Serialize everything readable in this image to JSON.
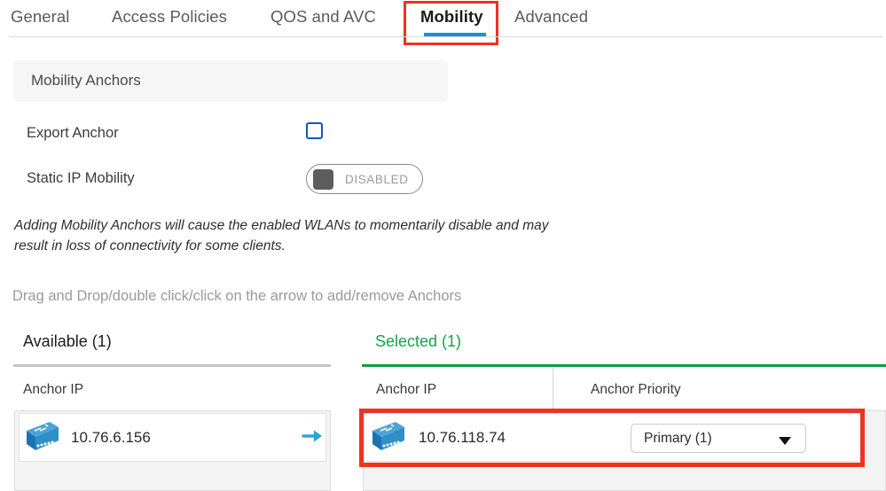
{
  "tabs": [
    {
      "label": "General",
      "active": false
    },
    {
      "label": "Access Policies",
      "active": false
    },
    {
      "label": "QOS and AVC",
      "active": false
    },
    {
      "label": "Mobility",
      "active": true
    },
    {
      "label": "Advanced",
      "active": false
    }
  ],
  "section": {
    "title": "Mobility Anchors"
  },
  "form": {
    "export_anchor": {
      "label": "Export Anchor",
      "checked": false
    },
    "static_ip_mobility": {
      "label": "Static IP Mobility",
      "state": "DISABLED"
    }
  },
  "notes": {
    "warning": "Adding Mobility Anchors will cause the enabled WLANs to momentarily disable and may result in loss of connectivity for some clients.",
    "instruction": "Drag and Drop/double click/click on the arrow to add/remove Anchors"
  },
  "available_panel": {
    "title": "Available (1)",
    "columns": [
      "Anchor IP"
    ],
    "rows": [
      {
        "icon": "wlc-device-icon",
        "anchor_ip": "10.76.6.156",
        "action_icon": "arrow-right-icon"
      }
    ]
  },
  "selected_panel": {
    "title": "Selected (1)",
    "columns": [
      "Anchor IP",
      "Anchor Priority"
    ],
    "rows": [
      {
        "icon": "wlc-device-icon",
        "anchor_ip": "10.76.118.74",
        "priority": "Primary (1)"
      }
    ]
  },
  "colors": {
    "accent_blue": "#1f8fd4",
    "highlight_red": "#ee3322",
    "selected_green": "#0f9d3f",
    "checkbox_blue": "#1155cc"
  }
}
